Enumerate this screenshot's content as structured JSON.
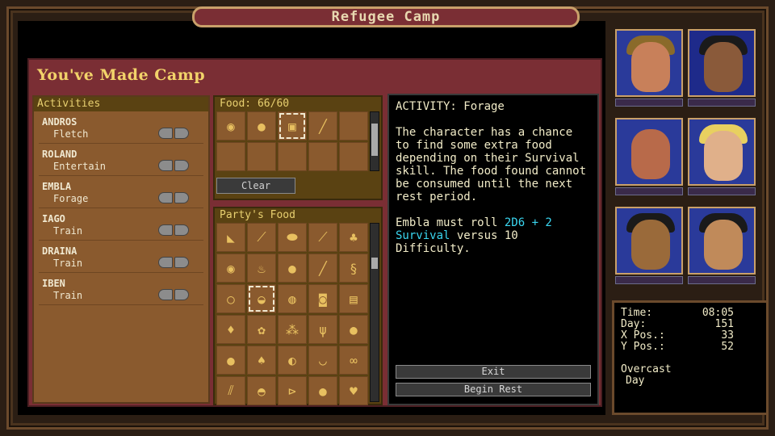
{
  "window_title": "Refugee Camp",
  "camp_title": "You've Made Camp",
  "activities": {
    "header": "Activities",
    "rows": [
      {
        "name": "ANDROS",
        "task": "Fletch"
      },
      {
        "name": "ROLAND",
        "task": "Entertain"
      },
      {
        "name": "EMBLA",
        "task": "Forage"
      },
      {
        "name": "IAGO",
        "task": "Train"
      },
      {
        "name": "DRAINA",
        "task": "Train"
      },
      {
        "name": "IBEN",
        "task": "Train"
      }
    ]
  },
  "food": {
    "header": "Food: 66/60",
    "clear_label": "Clear",
    "items": [
      "bread-roll",
      "bun",
      "bread-loaf",
      "sausage",
      "",
      "",
      "",
      "",
      "",
      ""
    ]
  },
  "party_food": {
    "header": "Party's Food",
    "items": [
      "cheese-wedge",
      "drumstick",
      "cheese-round",
      "carrot",
      "mushroom-cluster",
      "bread-roll",
      "meat-leg",
      "bun",
      "sausage",
      "worm",
      "egg",
      "pie",
      "fruit",
      "pouch",
      "jar",
      "radish",
      "herb",
      "grain",
      "leek",
      "lemon",
      "orange",
      "pepper",
      "bread",
      "bowl",
      "nut",
      "bottle",
      "gourd",
      "fish",
      "apple",
      "acorn"
    ]
  },
  "info": {
    "heading": "ACTIVITY: Forage",
    "description": "The character has a chance to find some extra food depending on their Survival skill. The food found cannot be consumed until the next rest period.",
    "roll_pre": "Embla must roll ",
    "roll_dice": "2D6 + 2",
    "roll_skill": "Survival",
    "roll_post": " versus 10 Difficulty.",
    "exit_label": "Exit",
    "rest_label": "Begin Rest"
  },
  "status": {
    "time_label": "Time:",
    "time_value": "08:05",
    "day_label": "Day:",
    "day_value": "151",
    "xpos_label": "X Pos.:",
    "xpos_value": "33",
    "ypos_label": "Y Pos.:",
    "ypos_value": "52",
    "weather_line1": "Overcast",
    "weather_line2": "Day"
  },
  "colors": {
    "accent_cyan": "#3ad6f0",
    "title_yellow": "#f2d36a",
    "panel_brown": "#8a5a2e",
    "window_red": "#7a2e34"
  }
}
